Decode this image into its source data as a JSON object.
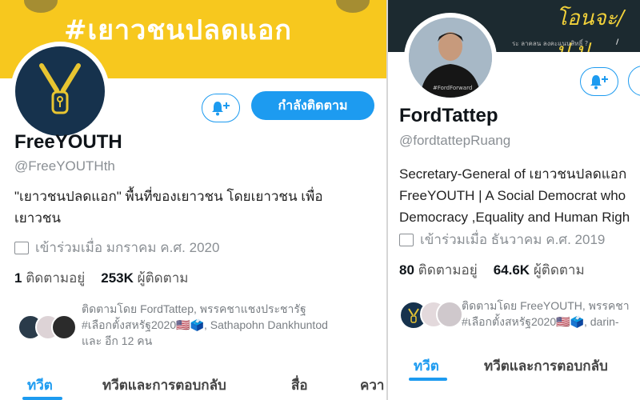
{
  "left": {
    "banner_hashtag": "#เยาวชนปลดแอก",
    "name": "FreeYOUTH",
    "handle": "@FreeYOUTHth",
    "bio_line1": "\"เยาวชนปลดแอก\" พื้นที่ของเยาวชน โดยเยาวชน เพื่อ",
    "bio_line2": "เยาวชน",
    "joined": "เข้าร่วมเมื่อ มกราคม ค.ศ. 2020",
    "following_count": "1",
    "following_label": "ติดตามอยู่",
    "followers_count": "253K",
    "followers_label": "ผู้ติดตาม",
    "followed_by_line1": "ติดตามโดย FordTattep, พรรคชาแชงประชารัฐ",
    "followed_by_line2": "#เลือกตั้งสหรัฐ2020🇺🇸🗳️, Sathapohn Dankhuntod",
    "followed_by_line3": "และ อีก 12 คน",
    "follow_button": "กำลังติดตาม",
    "tabs": [
      "ทวีต",
      "ทวีตและการตอบกลับ",
      "สื่อ",
      "ควา"
    ]
  },
  "right": {
    "banner_text": "โอนจะ/ป.ป.",
    "banner_small": "ระ ลาคลน ลงคะแนนสิทธิ์ ?",
    "banner_small2": "/",
    "avatar_caption": "#FordForward",
    "name": "FordTattep",
    "handle": "@fordtattepRuang",
    "bio_line1": "Secretary-General of เยาวชนปลดแอก",
    "bio_line2": "FreeYOUTH | A Social Democrat who",
    "bio_line3": "Democracy ,Equality and Human Righ",
    "joined": "เข้าร่วมเมื่อ ธันวาคม ค.ศ. 2019",
    "following_count": "80",
    "following_label": "ติดตามอยู่",
    "followers_count": "64.6K",
    "followers_label": "ผู้ติดตาม",
    "followed_by_line1": "ติดตามโดย FreeYOUTH, พรรคชา",
    "followed_by_line2": "#เลือกตั้งสหรัฐ2020🇺🇸🗳️, darin-",
    "tabs": [
      "ทวีต",
      "ทวีตและการตอบกลับ"
    ]
  },
  "colors": {
    "accent": "#1d9bf0",
    "banner_yellow": "#f7c81e",
    "logo_navy": "#16324d",
    "logo_gold": "#e8c531"
  }
}
